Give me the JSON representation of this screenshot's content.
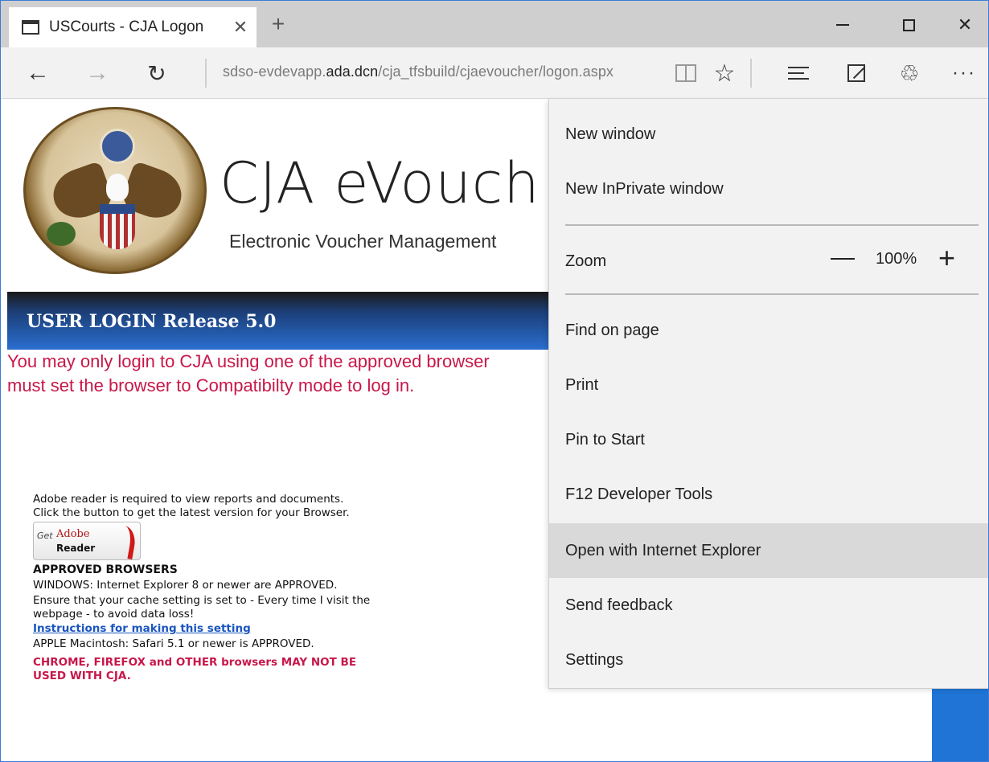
{
  "browser": {
    "tab_title": "USCourts - CJA Logon",
    "tab_close": "✕",
    "new_tab": "+",
    "window_close": "✕",
    "url_prefix": "sdso-evdevapp.",
    "url_domain": "ada.dcn",
    "url_path": "/cja_tfsbuild/cjaevoucher/logon.aspx",
    "back_glyph": "←",
    "forward_glyph": "→",
    "refresh_glyph": "↻",
    "favorite_glyph": "☆",
    "share_glyph": "♲",
    "more_glyph": "···"
  },
  "page": {
    "app_title": "CJA eVouch",
    "app_subtitle": "Electronic Voucher Management",
    "login_bar": "USER LOGIN Release 5.0",
    "warning_line1": "You may only login to CJA using one of the approved browser",
    "warning_line2": "must set the browser to Compatibilty mode to log in.",
    "info": {
      "adobe_text": "Adobe reader is required to view reports and documents. Click the button to get the latest version for your Browser.",
      "adobe_get": "Get",
      "adobe_name": "Adobe",
      "adobe_reader": "Reader",
      "approved_heading": "APPROVED BROWSERS",
      "windows_text": "WINDOWS: Internet Explorer 8 or newer are APPROVED.",
      "cache_text": "Ensure that your cache setting is set to - Every time I visit the webpage - to avoid data loss!",
      "instructions_link": "Instructions for making this setting",
      "apple_text": "APPLE Macintosh: Safari 5.1 or newer is APPROVED.",
      "other_warning": "CHROME, FIREFOX and OTHER browsers MAY NOT BE USED WITH CJA."
    }
  },
  "menu": {
    "new_window": "New window",
    "new_inprivate": "New InPrivate window",
    "zoom_label": "Zoom",
    "zoom_value": "100%",
    "zoom_plus": "+",
    "find_on_page": "Find on page",
    "print": "Print",
    "pin_to_start": "Pin to Start",
    "dev_tools": "F12 Developer Tools",
    "open_ie": "Open with Internet Explorer",
    "send_feedback": "Send feedback",
    "settings": "Settings"
  }
}
